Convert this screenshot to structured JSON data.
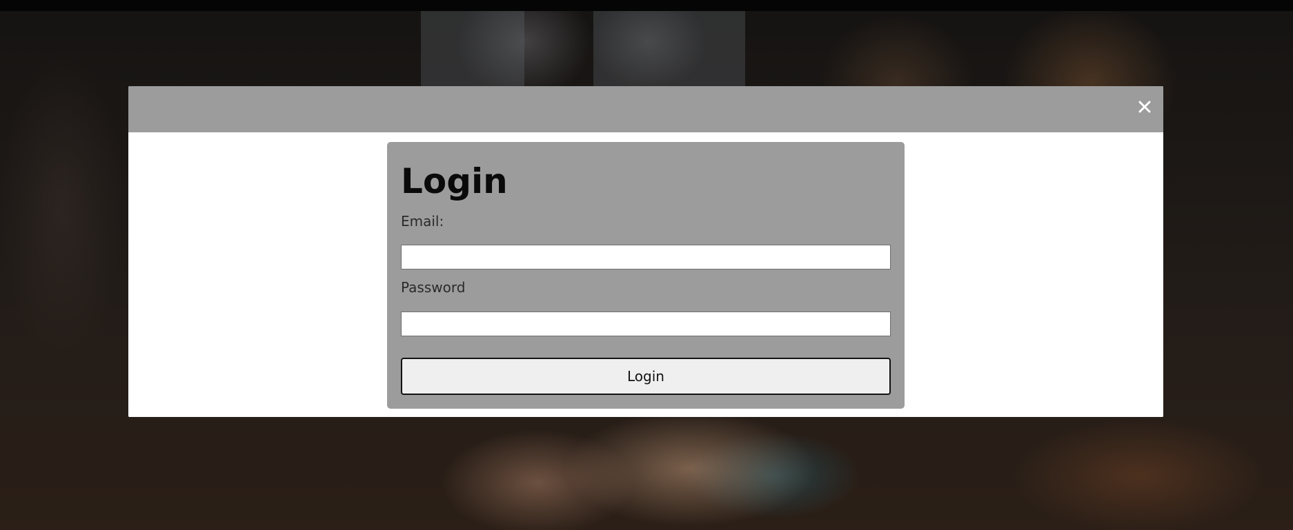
{
  "modal": {
    "close_icon": "close-icon"
  },
  "login_form": {
    "title": "Login",
    "email_label": "Email:",
    "email_value": "",
    "password_label": "Password",
    "password_value": "",
    "submit_label": "Login"
  },
  "colors": {
    "header_bg": "#9c9c9c",
    "card_bg": "#9c9c9c",
    "modal_bg": "#ffffff",
    "button_bg": "#efefef"
  }
}
